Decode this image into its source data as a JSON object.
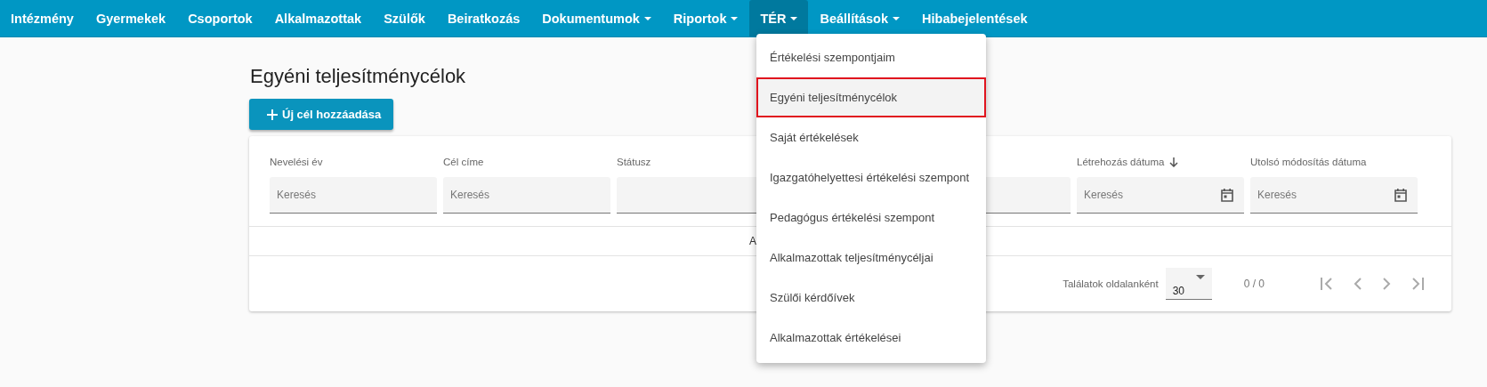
{
  "nav": {
    "items": [
      {
        "label": "Intézmény",
        "dropdown": false,
        "selected": false
      },
      {
        "label": "Gyermekek",
        "dropdown": false,
        "selected": false
      },
      {
        "label": "Csoportok",
        "dropdown": false,
        "selected": false
      },
      {
        "label": "Alkalmazottak",
        "dropdown": false,
        "selected": false
      },
      {
        "label": "Szülők",
        "dropdown": false,
        "selected": false
      },
      {
        "label": "Beiratkozás",
        "dropdown": false,
        "selected": false
      },
      {
        "label": "Dokumentumok",
        "dropdown": true,
        "selected": false
      },
      {
        "label": "Riportok",
        "dropdown": true,
        "selected": false
      },
      {
        "label": "TÉR",
        "dropdown": true,
        "selected": true
      },
      {
        "label": "Beállítások",
        "dropdown": true,
        "selected": false
      },
      {
        "label": "Hibabejelentések",
        "dropdown": false,
        "selected": false
      }
    ]
  },
  "page": {
    "title": "Egyéni teljesítménycélok",
    "add_button": "Új cél hozzáadása"
  },
  "table": {
    "filters": [
      {
        "label": "Nevelési év",
        "placeholder": "Keresés",
        "kind": "text",
        "sorted": false
      },
      {
        "label": "Cél címe",
        "placeholder": "Keresés",
        "kind": "text",
        "sorted": false
      },
      {
        "label": "Státusz",
        "kind": "select",
        "sorted": false
      },
      {
        "kind": "select",
        "sorted": false
      },
      {
        "label": "Létrehozás dátuma",
        "placeholder": "Keresés",
        "kind": "date",
        "sorted": true
      },
      {
        "label": "Utolsó módosítás dátuma",
        "placeholder": "Keresés",
        "kind": "date",
        "sorted": false
      }
    ],
    "empty_message": "A",
    "pagination": {
      "per_page_label": "Találatok oldalanként",
      "per_page": "30",
      "range": "0 / 0"
    }
  },
  "dropdown_menu": {
    "items": [
      {
        "label": "Értékelési szempontjaim",
        "selected": false
      },
      {
        "label": "Egyéni teljesítménycélok",
        "selected": true
      },
      {
        "label": "Saját értékelések",
        "selected": false
      },
      {
        "label": "Igazgatóhelyettesi értékelési szempont",
        "selected": false
      },
      {
        "label": "Pedagógus értékelési szempont",
        "selected": false
      },
      {
        "label": "Alkalmazottak teljesítménycéljai",
        "selected": false
      },
      {
        "label": "Szülői kérdőívek",
        "selected": false
      },
      {
        "label": "Alkalmazottak értékelései",
        "selected": false
      }
    ]
  }
}
